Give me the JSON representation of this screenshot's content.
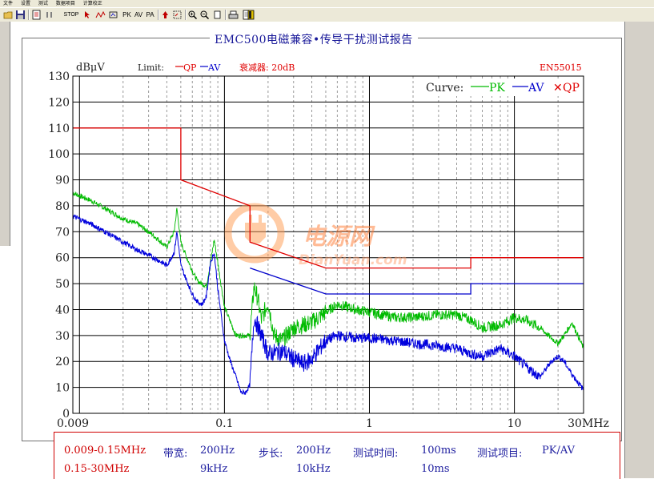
{
  "menu": [
    "文件",
    "设置",
    "测试",
    "数据项目",
    "计算校正"
  ],
  "toolbar": {
    "stop": "STOP",
    "pk": "PK",
    "av": "AV",
    "pa": "PA"
  },
  "report": {
    "title": "EMC500电磁兼容•传导干扰测试报告",
    "unit": "dBμV",
    "limit_label": "Limit:",
    "limit_qp": "QP",
    "limit_av": "AV",
    "attenuator": "衰减器: 20dB",
    "standard": "EN55015",
    "curve_label": "Curve:",
    "curve_pk": "PK",
    "curve_av": "AV",
    "curve_qp": "QP",
    "x_unit": "MHz"
  },
  "watermark": {
    "cn": "电源网",
    "en": "DianYuan.com"
  },
  "colors": {
    "qp": "#e00000",
    "av_limit": "#0000cc",
    "pk": "#00bb00",
    "av_trace": "#0000dd",
    "grid_major": "#000000",
    "grid_minor": "#808080",
    "axis_text": "#202020"
  },
  "chart_data": {
    "type": "line",
    "title": "",
    "xlabel": "MHz",
    "ylabel": "dBμV",
    "x_scale": "log",
    "xlim": [
      0.009,
      30
    ],
    "ylim": [
      0,
      130
    ],
    "y_ticks": [
      "0",
      "10",
      "20",
      "30",
      "40",
      "50",
      "60",
      "70",
      "80",
      "90",
      "100",
      "110",
      "120",
      "130"
    ],
    "x_ticks": [
      {
        "v": 0.009,
        "label": "0.009"
      },
      {
        "v": 0.1,
        "label": "0.1"
      },
      {
        "v": 1,
        "label": "1"
      },
      {
        "v": 10,
        "label": "10"
      },
      {
        "v": 30,
        "label": "30MHz"
      }
    ],
    "grid": true,
    "legend": "top-right",
    "series": [
      {
        "name": "QP",
        "role": "limit",
        "x": [
          0.009,
          0.05,
          0.05,
          0.15,
          0.15,
          0.5,
          5,
          5,
          30
        ],
        "y": [
          110,
          110,
          90,
          80,
          66,
          56,
          56,
          60,
          60
        ]
      },
      {
        "name": "AV",
        "role": "limit",
        "x": [
          0.15,
          0.5,
          5,
          5,
          30
        ],
        "y": [
          56,
          46,
          46,
          50,
          50
        ]
      },
      {
        "name": "PK",
        "role": "trace",
        "x": [
          0.009,
          0.012,
          0.015,
          0.02,
          0.025,
          0.03,
          0.035,
          0.04,
          0.045,
          0.047,
          0.05,
          0.055,
          0.06,
          0.065,
          0.07,
          0.075,
          0.08,
          0.085,
          0.09,
          0.1,
          0.12,
          0.14,
          0.15,
          0.16,
          0.17,
          0.18,
          0.2,
          0.22,
          0.25,
          0.3,
          0.4,
          0.5,
          0.6,
          0.8,
          1,
          1.5,
          2,
          3,
          4,
          5,
          6,
          8,
          10,
          12,
          15,
          18,
          20,
          22,
          25,
          30
        ],
        "y": [
          85,
          82,
          79,
          75,
          73,
          70,
          67,
          64,
          70,
          79,
          66,
          60,
          55,
          51,
          50,
          49,
          58,
          67,
          58,
          41,
          30,
          30,
          30,
          49,
          44,
          36,
          43,
          30,
          28,
          33,
          35,
          39,
          42,
          40,
          39,
          37,
          37,
          38,
          38,
          36,
          33,
          34,
          37,
          36,
          33,
          29,
          27,
          30,
          35,
          25
        ]
      },
      {
        "name": "AV",
        "role": "trace",
        "x": [
          0.009,
          0.012,
          0.015,
          0.02,
          0.025,
          0.03,
          0.035,
          0.04,
          0.045,
          0.047,
          0.05,
          0.055,
          0.06,
          0.065,
          0.07,
          0.075,
          0.08,
          0.085,
          0.09,
          0.1,
          0.11,
          0.12,
          0.13,
          0.14,
          0.15,
          0.16,
          0.18,
          0.2,
          0.25,
          0.3,
          0.35,
          0.4,
          0.5,
          0.6,
          0.8,
          1,
          1.5,
          2,
          3,
          4,
          5,
          6,
          8,
          10,
          12,
          15,
          18,
          20,
          22,
          25,
          30
        ],
        "y": [
          76,
          73,
          70,
          66,
          63,
          61,
          59,
          57,
          62,
          70,
          57,
          51,
          46,
          43,
          42,
          45,
          58,
          62,
          48,
          28,
          20,
          14,
          8,
          8,
          11,
          37,
          30,
          23,
          24,
          21,
          19,
          21,
          28,
          30,
          29,
          29,
          28,
          27,
          26,
          25,
          23,
          22,
          25,
          22,
          18,
          14,
          20,
          22,
          20,
          15,
          9
        ]
      }
    ]
  },
  "settings": {
    "rows": [
      {
        "range": "0.009-0.15MHz",
        "bw_label": "带宽:",
        "bw": "200Hz",
        "step_label": "步长:",
        "step": "200Hz",
        "time_label": "测试时间:",
        "time": "100ms",
        "item_label": "测试项目:",
        "item": "PK/AV"
      },
      {
        "range": "0.15-30MHz",
        "bw": "9kHz",
        "step": "10kHz",
        "time": "10ms"
      }
    ]
  }
}
